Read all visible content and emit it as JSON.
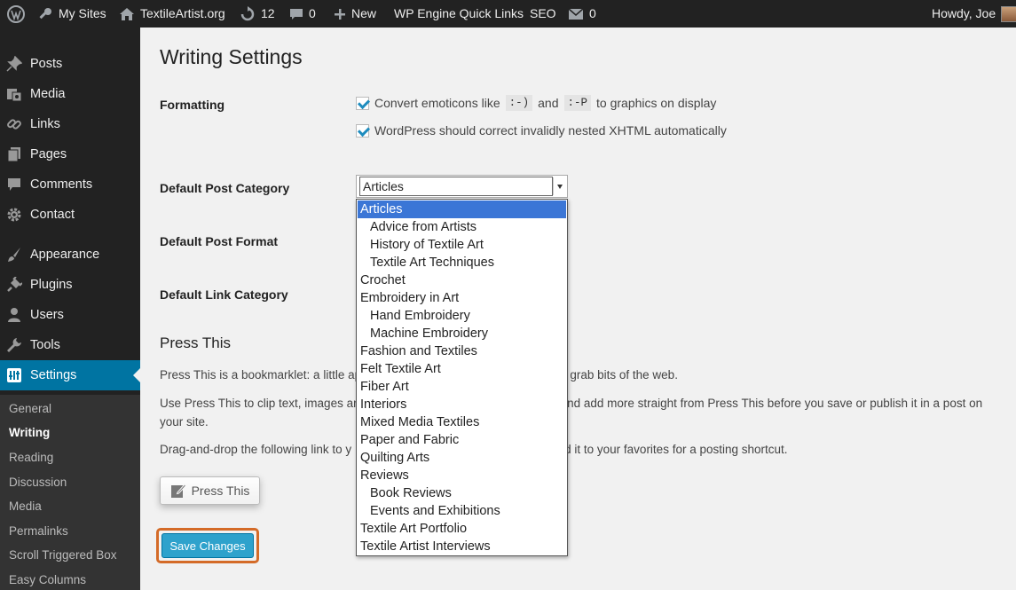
{
  "admin_bar": {
    "my_sites": "My Sites",
    "site_name": "TextileArtist.org",
    "updates_count": "12",
    "comments_count": "0",
    "new_label": "New",
    "wpengine_label": "WP Engine Quick Links",
    "seo_label": "SEO",
    "mail_count": "0",
    "howdy": "Howdy, Joe",
    "icons": [
      "wordpress-icon",
      "my-sites-icon",
      "home-icon",
      "updates-icon",
      "comments-icon",
      "plus-icon",
      "mail-icon",
      "avatar"
    ]
  },
  "sidebar": {
    "items": [
      {
        "label": "Posts",
        "icon": "pushpin-icon"
      },
      {
        "label": "Media",
        "icon": "media-icon"
      },
      {
        "label": "Links",
        "icon": "links-icon"
      },
      {
        "label": "Pages",
        "icon": "pages-icon"
      },
      {
        "label": "Comments",
        "icon": "comments-icon"
      },
      {
        "label": "Contact",
        "icon": "gear-icon"
      },
      {
        "label": "Appearance",
        "icon": "paintbrush-icon"
      },
      {
        "label": "Plugins",
        "icon": "plug-icon"
      },
      {
        "label": "Users",
        "icon": "user-icon"
      },
      {
        "label": "Tools",
        "icon": "wrench-icon"
      },
      {
        "label": "Settings",
        "icon": "settings-icon"
      }
    ],
    "current": "Settings",
    "submenu": [
      "General",
      "Writing",
      "Reading",
      "Discussion",
      "Media",
      "Permalinks",
      "Scroll Triggered Box",
      "Easy Columns"
    ],
    "submenu_active": "Writing"
  },
  "main": {
    "title": "Writing Settings",
    "formatting_label": "Formatting",
    "emoticons_pre": "Convert emoticons like",
    "emoticon_a": ":-)",
    "emoticons_and": "and",
    "emoticon_b": ":-P",
    "emoticons_post": "to graphics on display",
    "emoticons_checked": true,
    "xhtml_label": "WordPress should correct invalidly nested XHTML automatically",
    "xhtml_checked": true,
    "default_post_category_label": "Default Post Category",
    "default_post_format_label": "Default Post Format",
    "default_link_category_label": "Default Link Category",
    "category_select_value": "Articles",
    "category_options": [
      {
        "label": "Articles",
        "child": false,
        "selected": true
      },
      {
        "label": "Advice from Artists",
        "child": true
      },
      {
        "label": "History of Textile Art",
        "child": true
      },
      {
        "label": "Textile Art Techniques",
        "child": true
      },
      {
        "label": "Crochet",
        "child": false
      },
      {
        "label": "Embroidery in Art",
        "child": false
      },
      {
        "label": "Hand Embroidery",
        "child": true
      },
      {
        "label": "Machine Embroidery",
        "child": true
      },
      {
        "label": "Fashion and Textiles",
        "child": false
      },
      {
        "label": "Felt Textile Art",
        "child": false
      },
      {
        "label": "Fiber Art",
        "child": false
      },
      {
        "label": "Interiors",
        "child": false
      },
      {
        "label": "Mixed Media Textiles",
        "child": false
      },
      {
        "label": "Paper and Fabric",
        "child": false
      },
      {
        "label": "Quilting Arts",
        "child": false
      },
      {
        "label": "Reviews",
        "child": false
      },
      {
        "label": "Book Reviews",
        "child": true
      },
      {
        "label": "Events and Exhibitions",
        "child": true
      },
      {
        "label": "Textile Art Portfolio",
        "child": false
      },
      {
        "label": "Textile Artist Interviews",
        "child": false
      }
    ],
    "press_this_title": "Press This",
    "press_this_p1_a": "Press This is a bookmarklet: a little ap",
    "press_this_p1_b": "u grab bits of the web.",
    "press_this_p2_a": "Use Press This to clip text, images an",
    "press_this_p2_b": "and add more straight from Press This before you save or publish it in a post on",
    "press_this_p2_c": "your site.",
    "press_this_p3_a": "Drag-and-drop the following link to y",
    "press_this_p3_b": "add it to your favorites for a posting shortcut.",
    "press_this_button": "Press This",
    "save_button": "Save Changes"
  },
  "colors": {
    "admin_bar_bg": "#222222",
    "sidebar_bg": "#222222",
    "current_menu_bg": "#0074a2",
    "primary_button": "#2ea2cc",
    "highlight_outline": "#d46b28",
    "dropdown_selected": "#3b76d6"
  }
}
